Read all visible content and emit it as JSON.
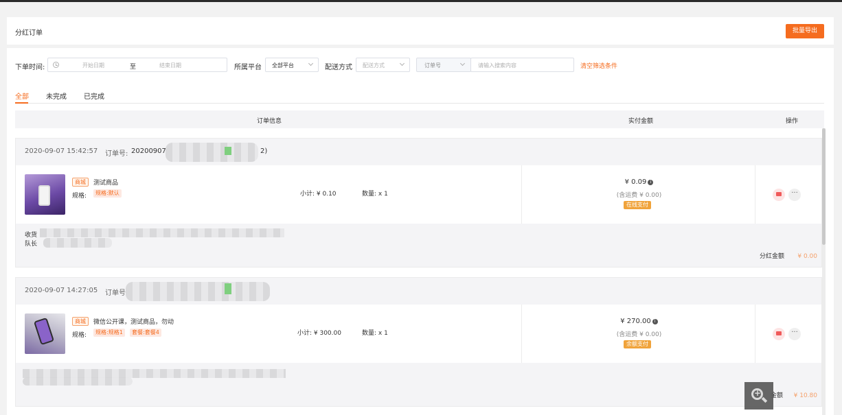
{
  "header": {
    "title": "分红订单",
    "export_label": "批量导出"
  },
  "filters": {
    "order_time_label": "下单时间:",
    "start_placeholder": "开始日期",
    "range_sep": "至",
    "end_placeholder": "结束日期",
    "platform_label": "所属平台",
    "platform_value": "全部平台",
    "delivery_label": "配送方式",
    "delivery_placeholder": "配送方式",
    "order_no_select": "订单号",
    "search_placeholder": "请输入搜索内容",
    "clear_label": "清空筛选条件"
  },
  "tabs": [
    {
      "label": "全部",
      "active": true
    },
    {
      "label": "未完成",
      "active": false
    },
    {
      "label": "已完成",
      "active": false
    }
  ],
  "table_header": {
    "order_info": "订单信息",
    "paid_amount": "实付金额",
    "actions": "操作"
  },
  "orders": [
    {
      "time": "2020-09-07 15:42:57",
      "order_no_label": "订单号:",
      "order_no": "20200907",
      "order_no_tail": "2)",
      "shop_tag": "商城",
      "product_name": "测试商品",
      "spec_label": "规格:",
      "spec_tags": [
        "规格:默认"
      ],
      "subtotal": "小计: ¥ 0.10",
      "quantity": "数量: x 1",
      "amount": "¥ 0.09",
      "shipping": "(含运费 ¥ 0.00)",
      "pay_method": "在线支付",
      "receiver_prefix": "收货",
      "leader_prefix": "队长",
      "dividend_label": "分红金额",
      "dividend_value": "¥ 0.00"
    },
    {
      "time": "2020-09-07 14:27:05",
      "order_no_label": "订单号",
      "shop_tag": "商城",
      "product_name": "微信公开课，测试商品，勿动",
      "spec_label": "规格:",
      "spec_tags": [
        "规格:规格1",
        "套餐:套餐4"
      ],
      "subtotal": "小计: ¥ 300.00",
      "quantity": "数量: x 1",
      "amount": "¥ 270.00",
      "shipping": "(含运费 ¥ 0.00)",
      "pay_method": "余额支付",
      "dividend_label": "金额",
      "dividend_value": "¥ 10.80"
    }
  ],
  "icons": {
    "clock": "clock-icon",
    "chevron": "chevron-down-icon",
    "info": "info-icon",
    "message": "message-icon",
    "more": "more-icon",
    "zoom": "zoom-in-icon"
  },
  "colors": {
    "accent": "#f56c1f",
    "badge": "#f0a33b",
    "dividend": "#f5a06a"
  }
}
